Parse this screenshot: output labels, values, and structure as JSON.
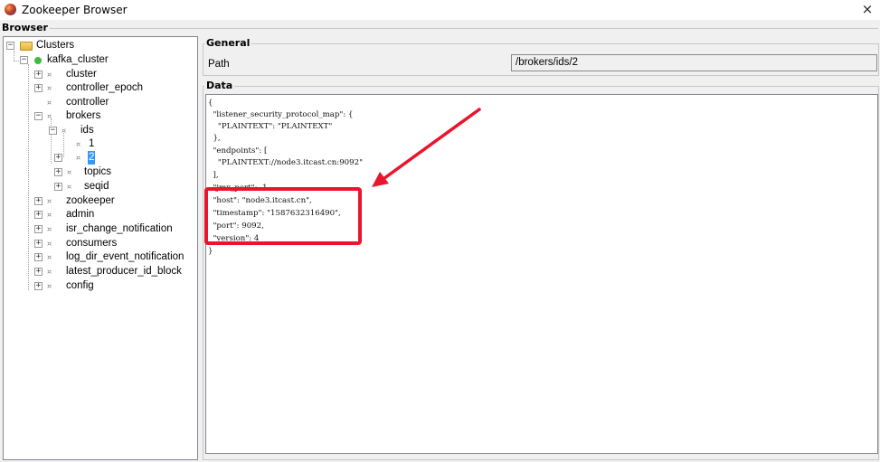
{
  "window": {
    "title": "Zookeeper Browser",
    "close_glyph": "×"
  },
  "browser_label": "Browser",
  "tree": {
    "root": "Clusters",
    "cluster": "kafka_cluster",
    "nodes": {
      "cluster": "cluster",
      "controller_epoch": "controller_epoch",
      "controller": "controller",
      "brokers": "brokers",
      "ids": "ids",
      "id1": "1",
      "id2": "2",
      "topics": "topics",
      "seqid": "seqid",
      "zookeeper": "zookeeper",
      "admin": "admin",
      "isr_change_notification": "isr_change_notification",
      "consumers": "consumers",
      "log_dir_event_notification": "log_dir_event_notification",
      "latest_producer_id_block": "latest_producer_id_block",
      "config": "config"
    },
    "expand_plus": "+",
    "expand_minus": "−",
    "node_glyph": "¤"
  },
  "general": {
    "label": "General",
    "path_label": "Path",
    "path_value": "/brokers/ids/2"
  },
  "data": {
    "label": "Data",
    "lines": [
      "{",
      "  \"listener_security_protocol_map\": {",
      "    \"PLAINTEXT\": \"PLAINTEXT\"",
      "  },",
      "  \"endpoints\": [",
      "    \"PLAINTEXT://node3.itcast.cn:9092\"",
      "  ],",
      "  \"jmx_port\": -1,",
      "  \"host\": \"node3.itcast.cn\",",
      "  \"timestamp\": \"1587632316490\",",
      "  \"port\": 9092,",
      "  \"version\": 4",
      "}"
    ]
  },
  "colors": {
    "highlight": "#e8152d",
    "selection": "#3399ff",
    "status_dot": "#3dbb3d"
  }
}
